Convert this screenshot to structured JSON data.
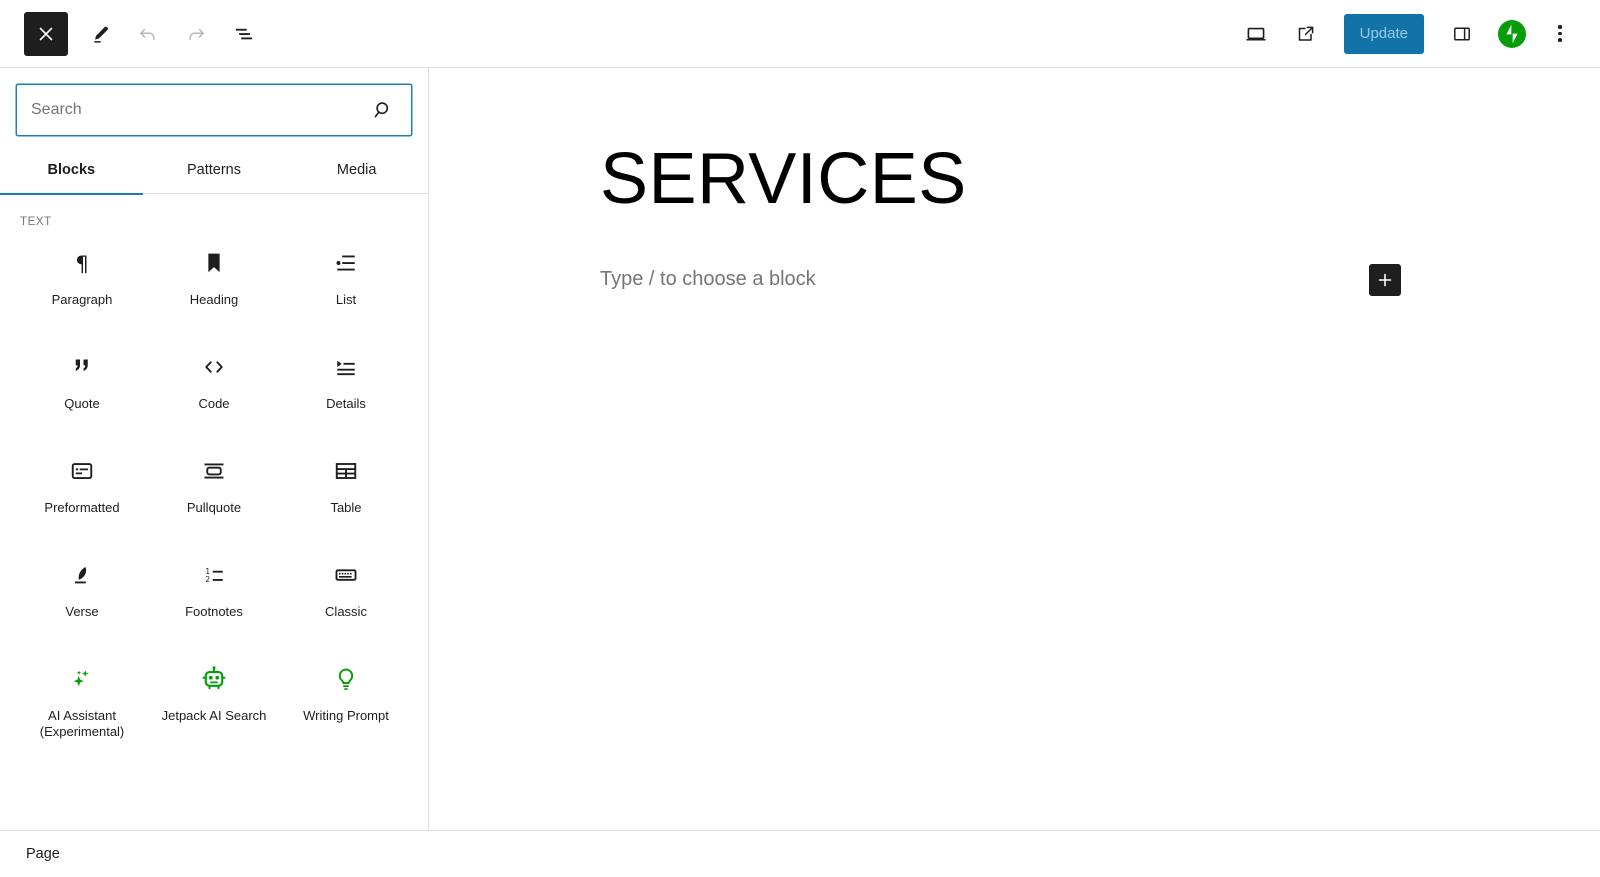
{
  "header": {
    "close_label": "Close",
    "edit_label": "Edit",
    "undo_label": "Undo",
    "redo_label": "Redo",
    "document_overview_label": "Document Overview",
    "view_label": "View",
    "preview_label": "Preview",
    "update_label": "Update",
    "settings_label": "Settings",
    "jetpack_label": "Jetpack",
    "options_label": "Options",
    "accent_color": "#1173a8",
    "jetpack_color": "#069e08"
  },
  "inserter": {
    "search": {
      "placeholder": "Search",
      "value": "",
      "icon": "search-icon",
      "focus_color": "#1f7cbf"
    },
    "tabs": [
      {
        "label": "Blocks",
        "active": true
      },
      {
        "label": "Patterns",
        "active": false
      },
      {
        "label": "Media",
        "active": false
      }
    ],
    "category": "TEXT",
    "blocks": [
      {
        "label": "Paragraph",
        "icon": "paragraph-icon",
        "color": "#1e1e1e"
      },
      {
        "label": "Heading",
        "icon": "heading-icon",
        "color": "#1e1e1e"
      },
      {
        "label": "List",
        "icon": "list-icon",
        "color": "#1e1e1e"
      },
      {
        "label": "Quote",
        "icon": "quote-icon",
        "color": "#1e1e1e"
      },
      {
        "label": "Code",
        "icon": "code-icon",
        "color": "#1e1e1e"
      },
      {
        "label": "Details",
        "icon": "details-icon",
        "color": "#1e1e1e"
      },
      {
        "label": "Preformatted",
        "icon": "preformatted-icon",
        "color": "#1e1e1e"
      },
      {
        "label": "Pullquote",
        "icon": "pullquote-icon",
        "color": "#1e1e1e"
      },
      {
        "label": "Table",
        "icon": "table-icon",
        "color": "#1e1e1e"
      },
      {
        "label": "Verse",
        "icon": "verse-icon",
        "color": "#1e1e1e"
      },
      {
        "label": "Footnotes",
        "icon": "footnotes-icon",
        "color": "#1e1e1e"
      },
      {
        "label": "Classic",
        "icon": "classic-icon",
        "color": "#1e1e1e"
      },
      {
        "label": "AI Assistant (Experimental)",
        "icon": "sparkles-icon",
        "color": "#069e08"
      },
      {
        "label": "Jetpack AI Search",
        "icon": "robot-icon",
        "color": "#069e08"
      },
      {
        "label": "Writing Prompt",
        "icon": "lightbulb-icon",
        "color": "#069e08"
      }
    ]
  },
  "editor": {
    "post_title": "SERVICES",
    "block_placeholder": "Type / to choose a block",
    "add_block_label": "Add block"
  },
  "breadcrumb": {
    "items": [
      "Page"
    ]
  }
}
